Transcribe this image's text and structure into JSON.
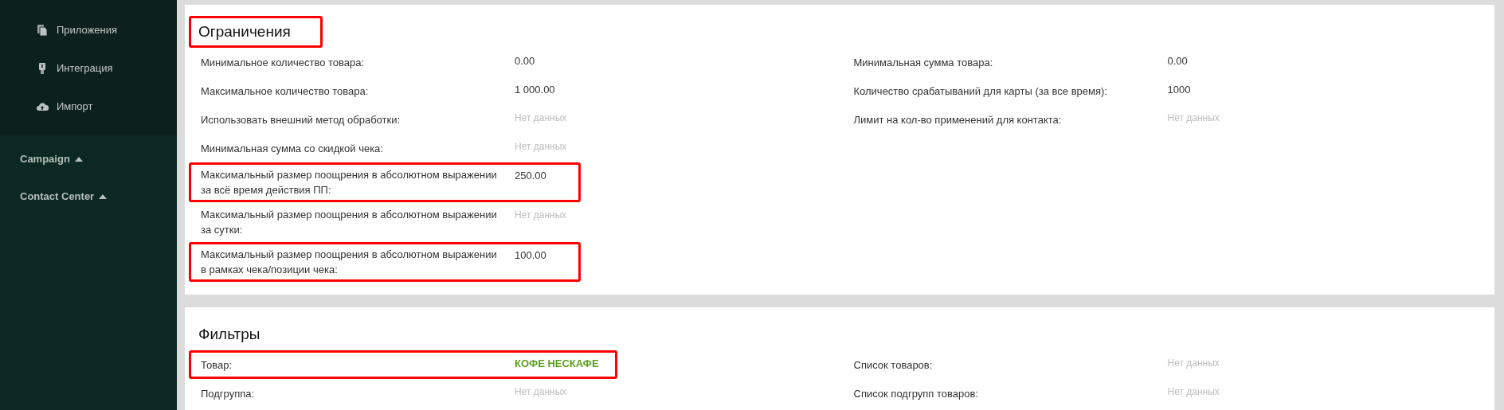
{
  "sidebar": {
    "items": [
      {
        "label": "Приложения"
      },
      {
        "label": "Интеграция"
      },
      {
        "label": "Импорт"
      }
    ],
    "groups": [
      {
        "label": "Campaign",
        "expanded": true
      },
      {
        "label": "Contact Center",
        "expanded": true
      }
    ]
  },
  "sections": [
    {
      "title": "Ограничения",
      "highlighted": true,
      "left": [
        {
          "label": "Минимальное количество товара:",
          "value": "0.00",
          "kind": "value",
          "highlighted": false
        },
        {
          "label": "Максимальное количество товара:",
          "value": "1 000.00",
          "kind": "value",
          "highlighted": false
        },
        {
          "label": "Использовать внешний метод обработки:",
          "value": "Нет данных",
          "kind": "empty",
          "highlighted": false
        },
        {
          "label": "Минимальная сумма со скидкой чека:",
          "value": "Нет данных",
          "kind": "empty",
          "highlighted": false
        },
        {
          "label": "Максимальный размер поощрения в абсолютном выражении за всё время действия ПП:",
          "value": "250.00",
          "kind": "value",
          "highlighted": true
        },
        {
          "label": "Максимальный размер поощрения в абсолютном выражении за сутки:",
          "value": "Нет данных",
          "kind": "empty",
          "highlighted": false
        },
        {
          "label": "Максимальный размер поощрения в абсолютном выражении в рамках чека/позиции чека:",
          "value": "100.00",
          "kind": "value",
          "highlighted": true
        }
      ],
      "right": [
        {
          "label": "Минимальная сумма товара:",
          "value": "0.00",
          "kind": "value",
          "highlighted": false
        },
        {
          "label": "Количество срабатываний для карты (за все время):",
          "value": "1000",
          "kind": "value",
          "highlighted": false
        },
        {
          "label": "Лимит на кол-во применений для контакта:",
          "value": "Нет данных",
          "kind": "empty",
          "highlighted": false
        }
      ]
    },
    {
      "title": "Фильтры",
      "highlighted": false,
      "left": [
        {
          "label": "Товар:",
          "value": "КОФЕ НЕСКАФЕ",
          "kind": "product",
          "highlighted": true
        },
        {
          "label": "Подгруппа:",
          "value": "Нет данных",
          "kind": "empty",
          "highlighted": false
        }
      ],
      "right": [
        {
          "label": "Список товаров:",
          "value": "Нет данных",
          "kind": "empty",
          "highlighted": false
        },
        {
          "label": "Список подгрупп товаров:",
          "value": "Нет данных",
          "kind": "empty",
          "highlighted": false
        }
      ]
    }
  ]
}
